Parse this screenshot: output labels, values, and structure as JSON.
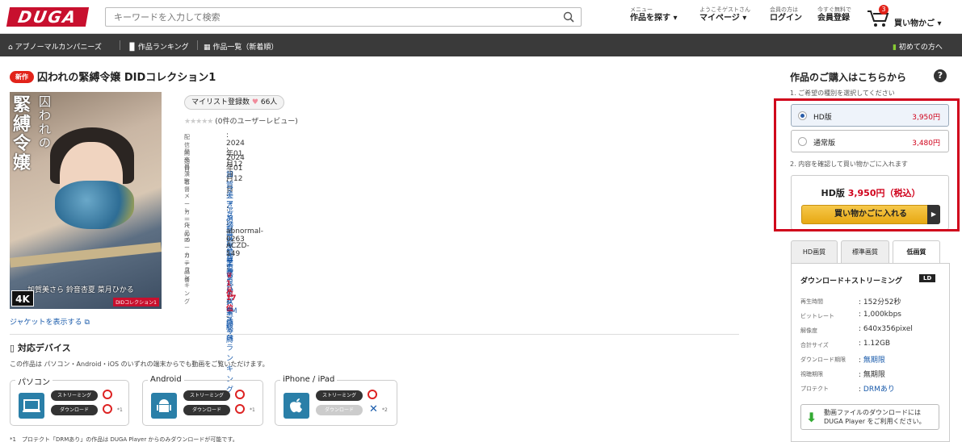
{
  "header": {
    "logo": "DUGA",
    "search_placeholder": "キーワードを入力して検索",
    "nav": [
      {
        "small": "メニュー",
        "label": "作品を探す"
      },
      {
        "small": "ようこそゲストさん",
        "label": "マイページ"
      },
      {
        "small": "会員の方は",
        "label": "ログイン"
      },
      {
        "small": "今すぐ無料で",
        "label": "会員登録"
      }
    ],
    "cart_count": "3",
    "cart_label": "買い物かご"
  },
  "subnav": {
    "items": [
      "アブノーマルカンパニーズ",
      "作品ランキング",
      "作品一覧（新着順）"
    ],
    "first_time": "初めての方へ"
  },
  "product": {
    "badge": "新作",
    "title": "囚われの緊縛令嬢 DIDコレクション1",
    "cover": {
      "vertical_title": "緊縛令嬢",
      "vertical_small": "囚われの",
      "cast_line": "加賀美さら 鈴音杏夏 菜月ひかる",
      "quality_badge": "4K",
      "series_badge": "DIDコレクション1"
    },
    "jacket_link": "ジャケットを表示する",
    "mylist_label": "マイリスト登録数",
    "mylist_count": "66人",
    "stars": "★★★★★",
    "review_text": "(0件のユーザーレビュー)",
    "info": [
      {
        "k": "配信開始日",
        "v": "2024年01月12日"
      },
      {
        "k": "発売日",
        "v": "2024年01月12日"
      },
      {
        "k": "出演者",
        "v": "加賀美さら 鈴音杏夏 菜月ひかる"
      },
      {
        "k": "監督",
        "v": "マニア倶楽部編集部"
      },
      {
        "k": "メーカー",
        "v": "アブノーマルカンパニーズ"
      },
      {
        "k": "レーベル",
        "v": "アブノーマルカンパニーズ"
      },
      {
        "k": "作品ID",
        "v": "abnormal-0263"
      },
      {
        "k": "メーカー品番",
        "v": "ACZD-149"
      },
      {
        "k": "カテゴリ",
        "v": "アダルト > SM > 緊縛"
      },
      {
        "k": "ランキング",
        "v": "1位"
      }
    ],
    "rank1": {
      "pos": "1位",
      "name": "緊縛"
    },
    "rank2": {
      "pos": "17位",
      "name": "総合ランキング"
    }
  },
  "devices": {
    "heading": "対応デバイス",
    "text": "この作品は パソコン・Android・iOS のいずれの端末からでも動画をご覧いただけます。",
    "boxes": [
      {
        "label": "パソコン",
        "stream": "ストリーミング",
        "dl": "ダウンロード",
        "note": "*1"
      },
      {
        "label": "Android",
        "stream": "ストリーミング",
        "dl": "ダウンロード",
        "note": "*1"
      },
      {
        "label": "iPhone / iPad",
        "stream": "ストリーミング",
        "dl": "ダウンロード",
        "note": "*2"
      }
    ],
    "footnote": "*1　プロテクト「DRMあり」の作品は DUGA Player からのみダウンロードが可能です。"
  },
  "purchase": {
    "heading": "作品のご購入はこちらから",
    "step1": "1. ご希望の種別を選択してください",
    "options": [
      {
        "name": "HD版",
        "price": "3,950円",
        "selected": true
      },
      {
        "name": "通常版",
        "price": "3,480円",
        "selected": false
      }
    ],
    "step2": "2. 内容を確認して買い物かごに入れます",
    "summary_name": "HD版",
    "summary_price": "3,950円（税込）",
    "cart_button": "買い物かごに入れる"
  },
  "spec": {
    "tabs": [
      "HD画質",
      "標準画質",
      "低画質"
    ],
    "heading": "ダウンロード＋ストリーミング",
    "badge": "LD",
    "rows": [
      {
        "k": "再生時間",
        "v": "152分52秒"
      },
      {
        "k": "ビットレート",
        "v": "1,000kbps"
      },
      {
        "k": "解像度",
        "v": "640x356pixel"
      },
      {
        "k": "合計サイズ",
        "v": "1.12GB"
      },
      {
        "k": "ダウンロード期限",
        "v": "無期限"
      },
      {
        "k": "視聴期限",
        "v": "無期限"
      },
      {
        "k": "プロテクト",
        "v": "DRMあり"
      }
    ],
    "player_note_1": "動画ファイルのダウンロードには",
    "player_note_2": "DUGA Player をご利用ください。"
  },
  "colors": {
    "accent": "#c8102e",
    "price": "#d0021b",
    "link": "#1a5bab",
    "cart_button": "#f0b72f"
  }
}
